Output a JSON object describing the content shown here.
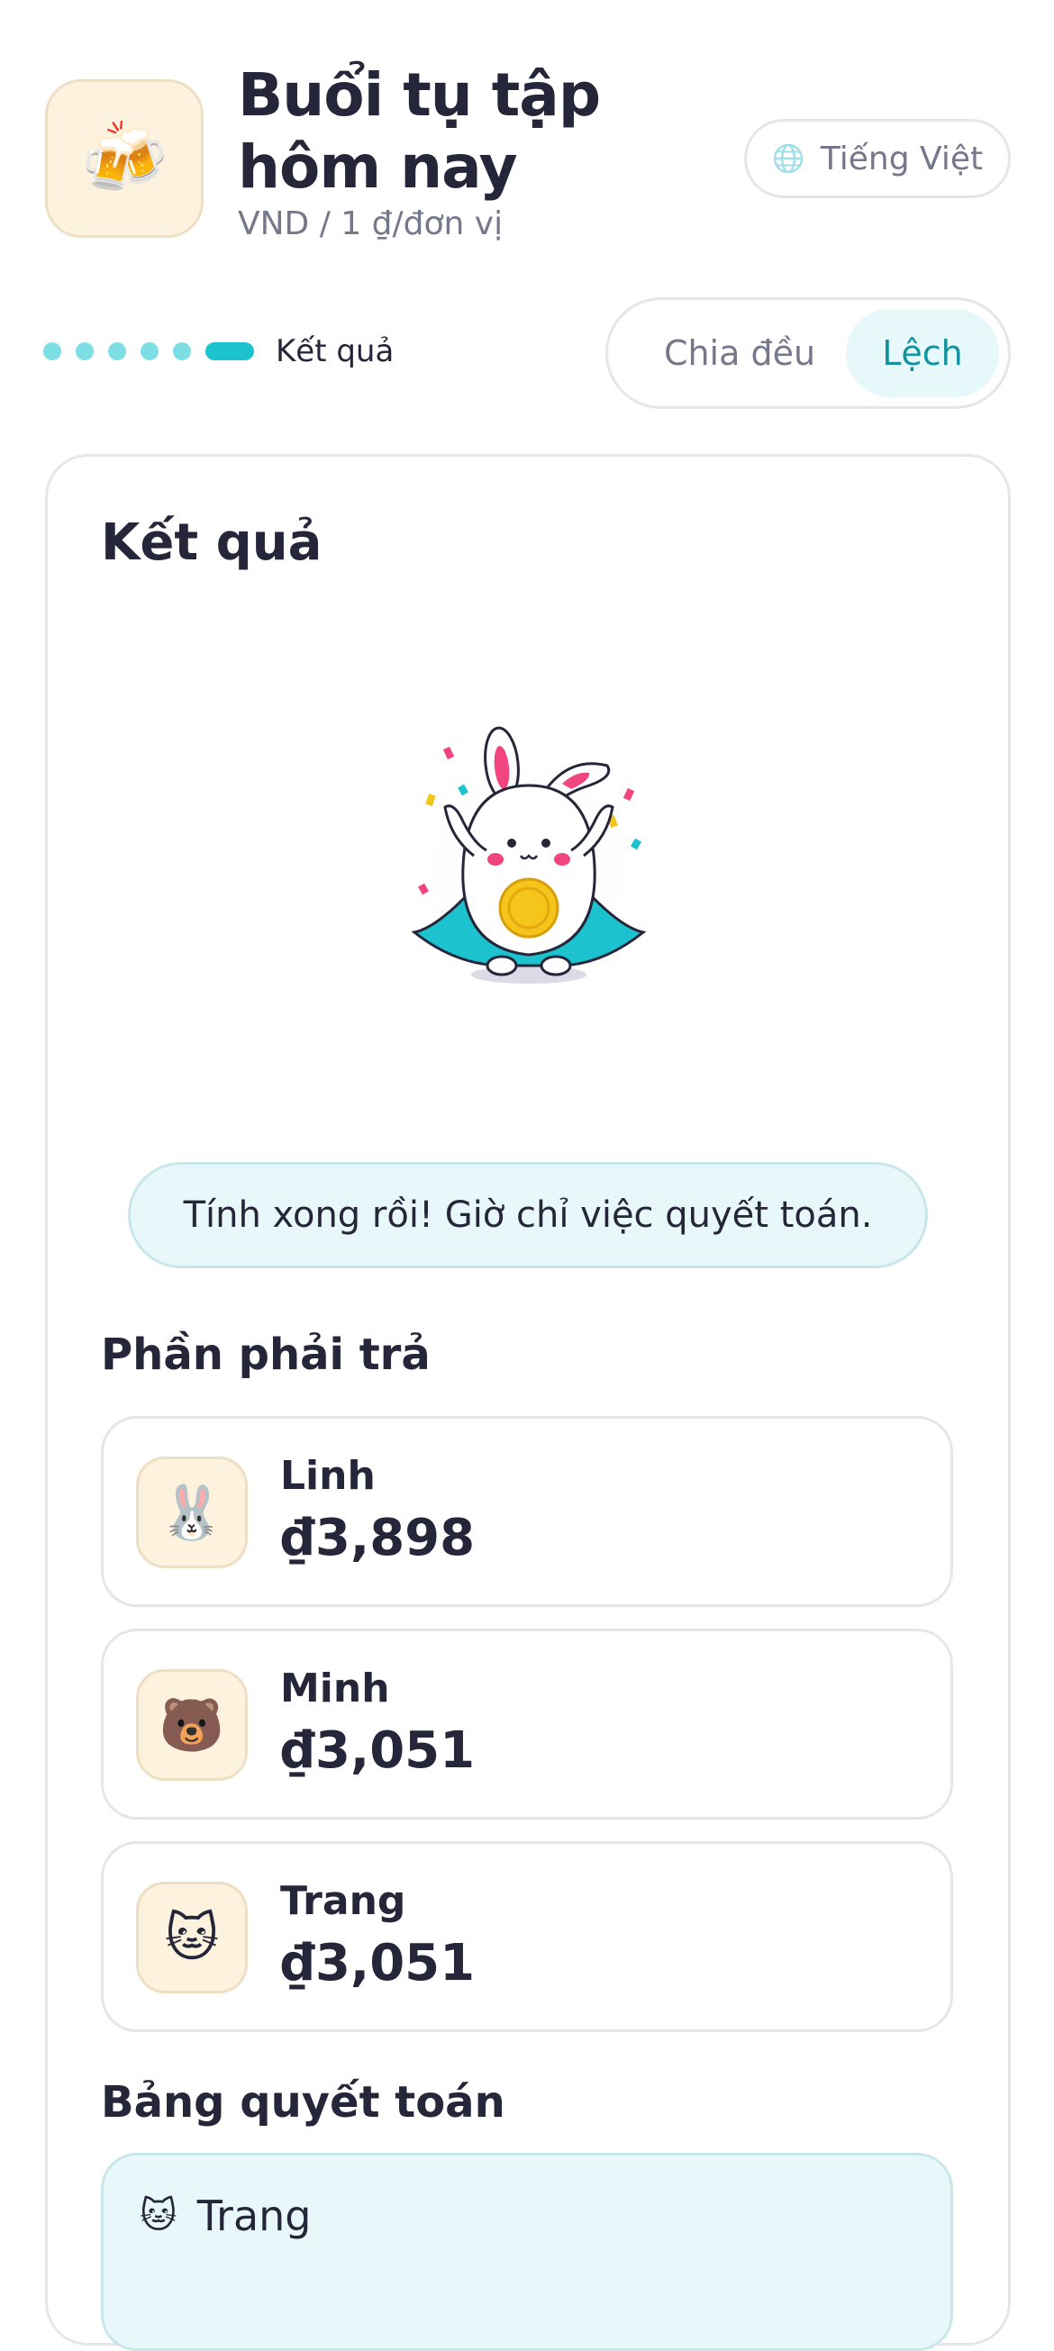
{
  "header": {
    "app_icon": "beer-mugs",
    "title": "Buổi tụ tập hôm nay",
    "subtitle": "VND / 1 ₫/đơn vị",
    "language_label": "Tiếng Việt"
  },
  "steps": {
    "total": 6,
    "current": 6,
    "current_label": "Kết quả"
  },
  "split_toggle": {
    "options": [
      "Chia đều",
      "Lệch"
    ],
    "selected": "Lệch"
  },
  "result": {
    "title": "Kết quả",
    "mascot": "celebrating-rabbit-with-coin",
    "message": "Tính xong rồi! Giờ chỉ việc quyết toán.",
    "owed_title": "Phần phải trả",
    "people": [
      {
        "name": "Linh",
        "amount": "₫3,898",
        "avatar": "🐰"
      },
      {
        "name": "Minh",
        "amount": "₫3,051",
        "avatar": "🐻"
      },
      {
        "name": "Trang",
        "amount": "₫3,051",
        "avatar": "🐱"
      }
    ],
    "settlement_title": "Bảng quyết toán",
    "settlement_rows": [
      {
        "name": "Trang",
        "avatar": "🐱"
      }
    ]
  },
  "colors": {
    "accent": "#1cc3cf",
    "accent_text": "#13939e",
    "accent_bg": "#e6f8fa",
    "avatar_bg": "#fdf2dd",
    "text": "#25263a",
    "muted": "#75788c"
  }
}
